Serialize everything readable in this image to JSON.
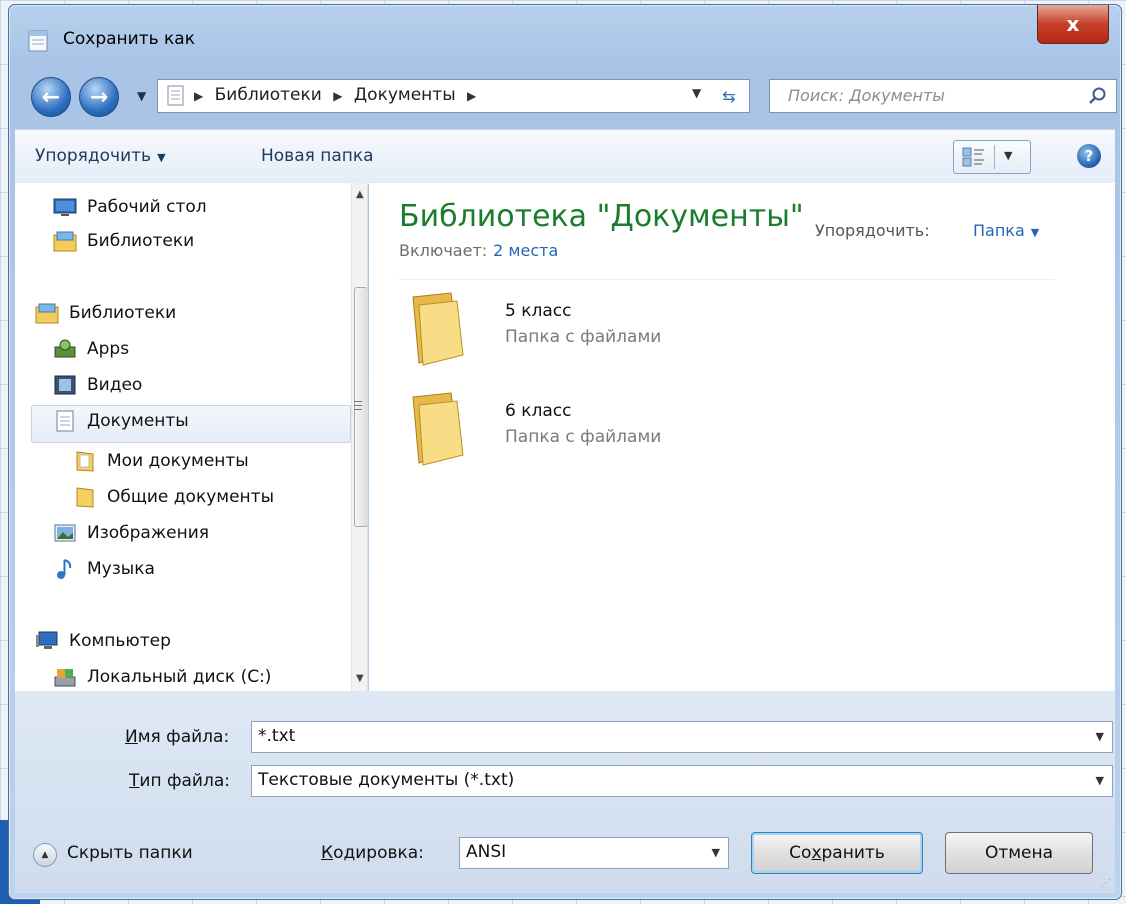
{
  "window": {
    "title": "Сохранить как",
    "close_label": "x"
  },
  "nav": {
    "breadcrumbs": [
      "Библиотеки",
      "Документы"
    ],
    "search_placeholder": "Поиск: Документы"
  },
  "toolbar": {
    "organize_label": "Упорядочить",
    "new_folder_label": "Новая папка"
  },
  "sidebar": {
    "items": [
      {
        "label": "Рабочий стол",
        "icon": "desktop-icon"
      },
      {
        "label": "Библиотеки",
        "icon": "libraries-icon"
      },
      {
        "label": "Библиотеки",
        "icon": "libraries-icon"
      },
      {
        "label": "Apps",
        "icon": "apps-icon"
      },
      {
        "label": "Видео",
        "icon": "video-icon"
      },
      {
        "label": "Документы",
        "icon": "documents-icon",
        "selected": true
      },
      {
        "label": "Мои документы",
        "icon": "folder-icon"
      },
      {
        "label": "Общие документы",
        "icon": "folder-icon"
      },
      {
        "label": "Изображения",
        "icon": "pictures-icon"
      },
      {
        "label": "Музыка",
        "icon": "music-icon"
      },
      {
        "label": "Компьютер",
        "icon": "computer-icon"
      },
      {
        "label": "Локальный диск (C:)",
        "icon": "disk-icon"
      }
    ]
  },
  "content": {
    "library_title": "Библиотека \"Документы\"",
    "includes_label": "Включает:",
    "includes_link": "2 места",
    "arrange_label": "Упорядочить:",
    "arrange_value": "Папка",
    "folders": [
      {
        "name": "5 класс",
        "type": "Папка с файлами"
      },
      {
        "name": "6 класс",
        "type": "Папка с файлами"
      }
    ]
  },
  "form": {
    "filename_label_u": "И",
    "filename_label_rest": "мя файла:",
    "filename_value": "*.txt",
    "filetype_label_u": "Т",
    "filetype_label_rest": "ип файла:",
    "filetype_value": "Текстовые документы (*.txt)",
    "hide_folders_label": "Скрыть папки",
    "encoding_label_u": "К",
    "encoding_label_rest": "одировка:",
    "encoding_value": "ANSI",
    "save_label_pre": "Со",
    "save_label_u": "х",
    "save_label_post": "ранить",
    "cancel_label": "Отмена"
  },
  "colors": {
    "library_title": "#1a7d2e",
    "link": "#2466b5",
    "close_button": "#c5402a"
  }
}
